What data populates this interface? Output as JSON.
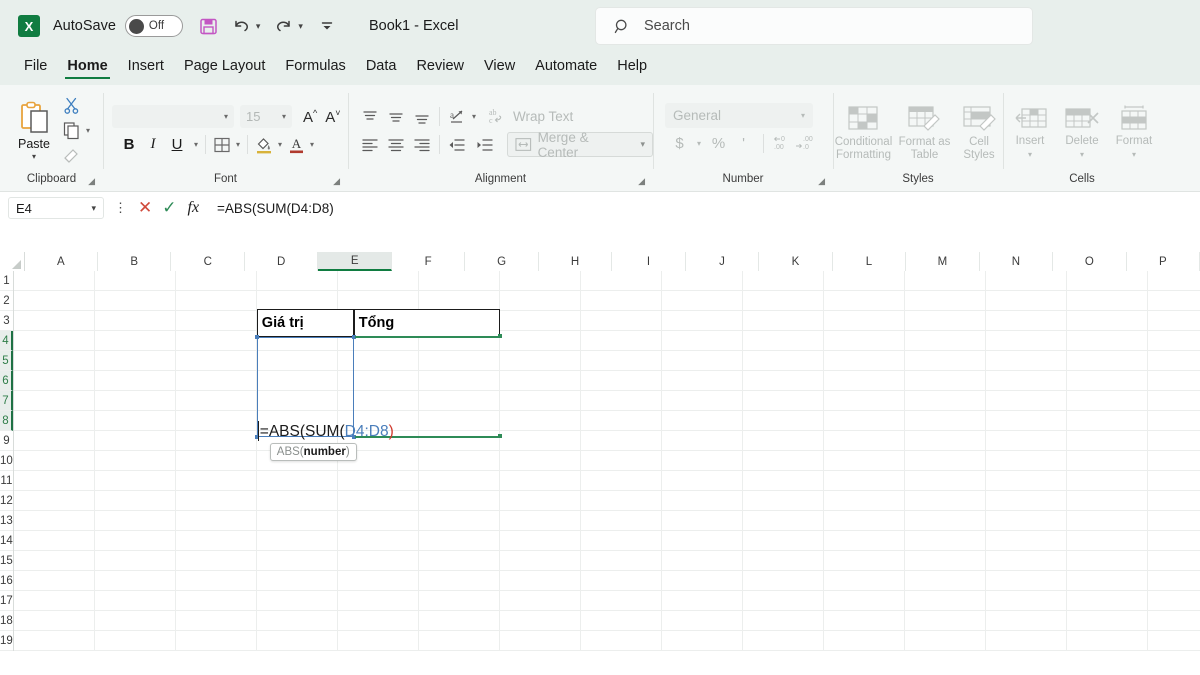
{
  "titlebar": {
    "app_icon": "excel-logo",
    "app_icon_letter": "X",
    "autosave_label": "AutoSave",
    "autosave_state": "Off",
    "save_icon": "save-icon",
    "undo_icon": "undo-icon",
    "redo_icon": "redo-icon",
    "more_icon": "customize-quick-access-toolbar-icon",
    "document_title": "Book1  -  Excel",
    "search_icon": "search-icon",
    "search_placeholder": "Search"
  },
  "tabs": [
    {
      "label": "File",
      "active": false
    },
    {
      "label": "Home",
      "active": true
    },
    {
      "label": "Insert",
      "active": false
    },
    {
      "label": "Page Layout",
      "active": false
    },
    {
      "label": "Formulas",
      "active": false
    },
    {
      "label": "Data",
      "active": false
    },
    {
      "label": "Review",
      "active": false
    },
    {
      "label": "View",
      "active": false
    },
    {
      "label": "Automate",
      "active": false
    },
    {
      "label": "Help",
      "active": false
    }
  ],
  "ribbon": {
    "clipboard": {
      "group_label": "Clipboard",
      "paste_label": "Paste",
      "cut_icon": "scissors-icon",
      "copy_icon": "copy-icon",
      "format_painter_icon": "format-painter-icon"
    },
    "font": {
      "group_label": "Font",
      "font_name": "",
      "font_size": "15",
      "grow_font_label": "A",
      "shrink_font_label": "A",
      "bold_label": "B",
      "italic_label": "I",
      "underline_label": "U",
      "borders_icon": "borders-icon",
      "fill_color_icon": "fill-color-icon",
      "font_color_icon": "font-color-icon"
    },
    "alignment": {
      "group_label": "Alignment",
      "wrap_text_label": "Wrap Text",
      "merge_center_label": "Merge & Center",
      "orientation_icon": "orientation-icon",
      "decrease_indent_icon": "decrease-indent-icon",
      "increase_indent_icon": "increase-indent-icon"
    },
    "number": {
      "group_label": "Number",
      "format_value": "General",
      "currency_label": "$",
      "percent_label": "%",
      "comma_label": "'",
      "increase_decimal_icon": "increase-decimal-icon",
      "decrease_decimal_icon": "decrease-decimal-icon"
    },
    "styles": {
      "group_label": "Styles",
      "items": [
        {
          "line1": "Conditional",
          "line2": "Formatting",
          "caret": true
        },
        {
          "line1": "Format as",
          "line2": "Table",
          "caret": true
        },
        {
          "line1": "Cell",
          "line2": "Styles",
          "caret": true
        }
      ]
    },
    "cells": {
      "group_label": "Cells",
      "items": [
        {
          "line1": "Insert",
          "caret": true
        },
        {
          "line1": "Delete",
          "caret": true
        },
        {
          "line1": "Format",
          "caret": true
        }
      ]
    }
  },
  "formula_bar": {
    "name_box_value": "E4",
    "name_box_caret_icon": "chevron-down-icon",
    "more_icon": "more-options-icon",
    "cancel_icon": "cancel-icon",
    "enter_icon": "enter-icon",
    "insert_function_icon": "insert-function-icon",
    "formula_value": "=ABS(SUM(D4:D8)"
  },
  "grid": {
    "columns": [
      "A",
      "B",
      "C",
      "D",
      "E",
      "F",
      "G",
      "H",
      "I",
      "J",
      "K",
      "L",
      "M",
      "N",
      "O",
      "P"
    ],
    "selected_column": "E",
    "rows": [
      "1",
      "2",
      "3",
      "4",
      "5",
      "6",
      "7",
      "8",
      "9",
      "10",
      "11",
      "12",
      "13",
      "14",
      "15",
      "16",
      "17",
      "18",
      "19"
    ],
    "highlighted_rows": [
      "4",
      "5",
      "6",
      "7",
      "8"
    ],
    "cells": [
      {
        "ref": "D3",
        "value": "Giá trị",
        "bold": true
      },
      {
        "ref": "E3",
        "value": "Tổng",
        "bold": true
      }
    ],
    "editing": {
      "cell": "E4",
      "text_plain": "=ABS(SUM(",
      "text_reference": "D4:D8",
      "text_close_paren": ")",
      "range_highlight": "D4:D8",
      "range_highlight_color": "#4a7ebb",
      "edit_border_color": "#2e8b57"
    },
    "tooltip": {
      "function_name": "ABS(",
      "argument": "number",
      "close": ")"
    }
  },
  "colors": {
    "accent_green": "#107c41",
    "titlebar_bg": "#e8efec",
    "ribbon_bg": "#f4f7f6",
    "reference_blue": "#4a7ebb",
    "paren_red": "#cf3a2e"
  }
}
